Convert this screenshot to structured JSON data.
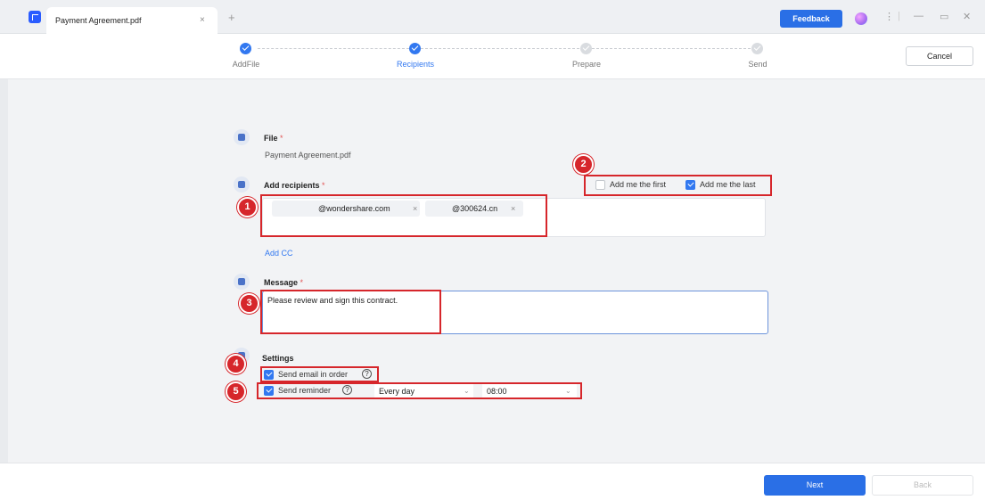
{
  "titlebar": {
    "tab_title": "Payment Agreement.pdf",
    "tab_close": "×",
    "tab_add": "+",
    "feedback_label": "Feedback",
    "menu_icon": "⋮",
    "minimize": "—",
    "maximize": "▭",
    "close": "✕"
  },
  "steps": [
    {
      "label": "AddFile",
      "state": "done"
    },
    {
      "label": "Recipients",
      "state": "active"
    },
    {
      "label": "Prepare",
      "state": "pending"
    },
    {
      "label": "Send",
      "state": "pending"
    }
  ],
  "cancel_label": "Cancel",
  "file": {
    "title": "File",
    "required_mark": "*",
    "filename": "Payment Agreement.pdf"
  },
  "recipients": {
    "title": "Add recipients",
    "required_mark": "*",
    "add_me_first": {
      "label": "Add me the first",
      "checked": false
    },
    "add_me_last": {
      "label": "Add me the last",
      "checked": true
    },
    "chips": [
      "@wondershare.com",
      "@300624.cn"
    ],
    "chip_remove": "×",
    "add_cc": "Add CC"
  },
  "message": {
    "title": "Message",
    "required_mark": "*",
    "value": "Please review and sign this contract."
  },
  "settings": {
    "title": "Settings",
    "send_in_order": {
      "label": "Send email in order",
      "checked": true
    },
    "send_reminder": {
      "label": "Send reminder",
      "checked": true
    },
    "help_glyph": "?",
    "frequency": "Every day",
    "time": "08:00",
    "chevron": "⌄"
  },
  "annotations": [
    "1",
    "2",
    "3",
    "4",
    "5"
  ],
  "footer": {
    "next_label": "Next",
    "back_label": "Back"
  },
  "colors": {
    "accent": "#2a6fe6",
    "annotation": "#d6262b",
    "required": "#e25555"
  }
}
